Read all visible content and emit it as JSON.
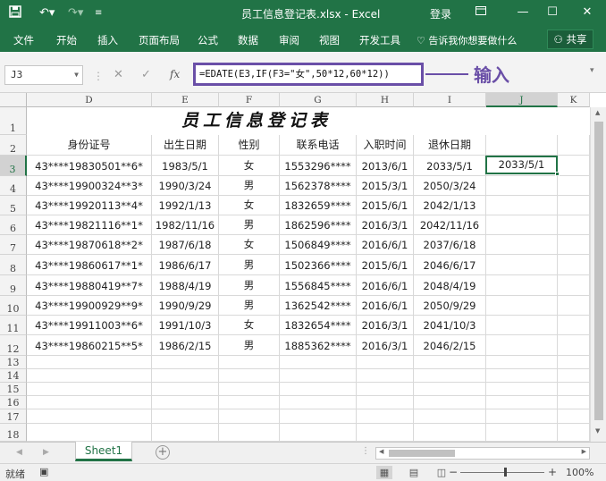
{
  "titlebar": {
    "save_icon": "save-icon",
    "undo_icon": "undo-icon",
    "redo_icon": "redo-icon",
    "title": "员工信息登记表.xlsx  -  Excel",
    "login": "登录"
  },
  "ribbon": {
    "tabs": [
      "文件",
      "开始",
      "插入",
      "页面布局",
      "公式",
      "数据",
      "审阅",
      "视图",
      "开发工具"
    ],
    "tell_me": "告诉我你想要做什么",
    "share": "共享"
  },
  "formula_bar": {
    "name_box": "J3",
    "formula": "=EDATE(E3,IF(F3=\"女\",50*12,60*12))",
    "annotation": "输入"
  },
  "columns": [
    "D",
    "E",
    "F",
    "G",
    "H",
    "I",
    "J",
    "K"
  ],
  "selected_column": "J",
  "rows": [
    "1",
    "2",
    "3",
    "4",
    "5",
    "6",
    "7",
    "8",
    "9",
    "10",
    "11",
    "12",
    "13",
    "14",
    "15",
    "16",
    "17",
    "18"
  ],
  "selected_row": "3",
  "sheet": {
    "title": "员工信息登记表",
    "headers": [
      "身份证号",
      "出生日期",
      "性别",
      "联系电话",
      "入职时间",
      "退休日期"
    ],
    "data": [
      [
        "43****19830501**6*",
        "1983/5/1",
        "女",
        "1553296****",
        "2013/6/1",
        "2033/5/1"
      ],
      [
        "43****19900324**3*",
        "1990/3/24",
        "男",
        "1562378****",
        "2015/3/1",
        "2050/3/24"
      ],
      [
        "43****19920113**4*",
        "1992/1/13",
        "女",
        "1832659****",
        "2015/6/1",
        "2042/1/13"
      ],
      [
        "43****19821116**1*",
        "1982/11/16",
        "男",
        "1862596****",
        "2016/3/1",
        "2042/11/16"
      ],
      [
        "43****19870618**2*",
        "1987/6/18",
        "女",
        "1506849****",
        "2016/6/1",
        "2037/6/18"
      ],
      [
        "43****19860617**1*",
        "1986/6/17",
        "男",
        "1502366****",
        "2015/6/1",
        "2046/6/17"
      ],
      [
        "43****19880419**7*",
        "1988/4/19",
        "男",
        "1556845****",
        "2016/6/1",
        "2048/4/19"
      ],
      [
        "43****19900929**9*",
        "1990/9/29",
        "男",
        "1362542****",
        "2016/6/1",
        "2050/9/29"
      ],
      [
        "43****19911003**6*",
        "1991/10/3",
        "女",
        "1832654****",
        "2016/3/1",
        "2041/10/3"
      ],
      [
        "43****19860215**5*",
        "1986/2/15",
        "男",
        "1885362****",
        "2016/3/1",
        "2046/2/15"
      ]
    ],
    "active_cell_value": "2033/5/1"
  },
  "sheet_tabs": [
    "Sheet1"
  ],
  "status": {
    "ready": "就绪",
    "zoom": "100%"
  },
  "colors": {
    "excel_green": "#217346",
    "annotation_purple": "#6a4fa7"
  }
}
